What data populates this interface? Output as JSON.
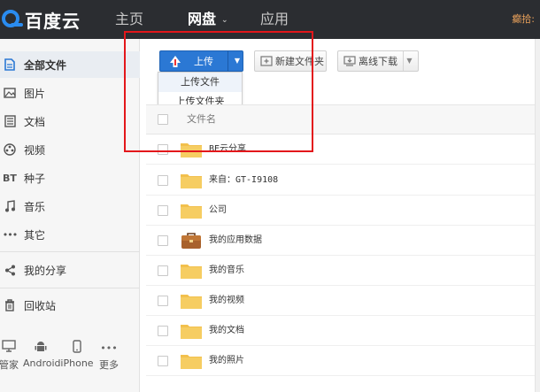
{
  "app": {
    "logo_text": "百度云"
  },
  "nav": {
    "items": [
      {
        "label": "主页",
        "active": false
      },
      {
        "label": "网盘",
        "active": true
      },
      {
        "label": "应用",
        "active": false
      }
    ],
    "user_partial": "癫拾:"
  },
  "sidebar": {
    "items": [
      {
        "label": "全部文件",
        "icon": "file-icon",
        "active": true
      },
      {
        "label": "图片",
        "icon": "image-icon"
      },
      {
        "label": "文档",
        "icon": "document-icon"
      },
      {
        "label": "视频",
        "icon": "video-icon"
      },
      {
        "label": "种子",
        "icon": "torrent-icon",
        "icon_text": "BT"
      },
      {
        "label": "音乐",
        "icon": "music-icon"
      },
      {
        "label": "其它",
        "icon": "more-dots-icon"
      },
      {
        "label": "我的分享",
        "icon": "share-icon"
      },
      {
        "label": "回收站",
        "icon": "trash-icon"
      }
    ],
    "devices": [
      {
        "label": "管家",
        "icon": "monitor-icon"
      },
      {
        "label": "Android",
        "icon": "android-icon"
      },
      {
        "label": "iPhone",
        "icon": "phone-icon"
      },
      {
        "label": "更多",
        "icon": "more-dots-icon"
      }
    ]
  },
  "toolbar": {
    "upload_label": "上传",
    "new_folder_label": "新建文件夹",
    "offline_download_label": "离线下载"
  },
  "upload_menu": {
    "items": [
      "上传文件",
      "上传文件夹"
    ]
  },
  "file_list": {
    "header_name": "文件名",
    "rows": [
      {
        "name": "BE云分享",
        "type": "folder"
      },
      {
        "name": "来自：GT-I9108",
        "type": "folder"
      },
      {
        "name": "公司",
        "type": "folder"
      },
      {
        "name": "我的应用数据",
        "type": "app-folder"
      },
      {
        "name": "我的音乐",
        "type": "folder"
      },
      {
        "name": "我的视频",
        "type": "folder"
      },
      {
        "name": "我的文档",
        "type": "folder"
      },
      {
        "name": "我的照片",
        "type": "folder"
      }
    ]
  },
  "colors": {
    "topbar": "#2b2d31",
    "upload_button": "#2b78d4",
    "folder": "#f2c04d",
    "highlight": "#e3171b"
  }
}
